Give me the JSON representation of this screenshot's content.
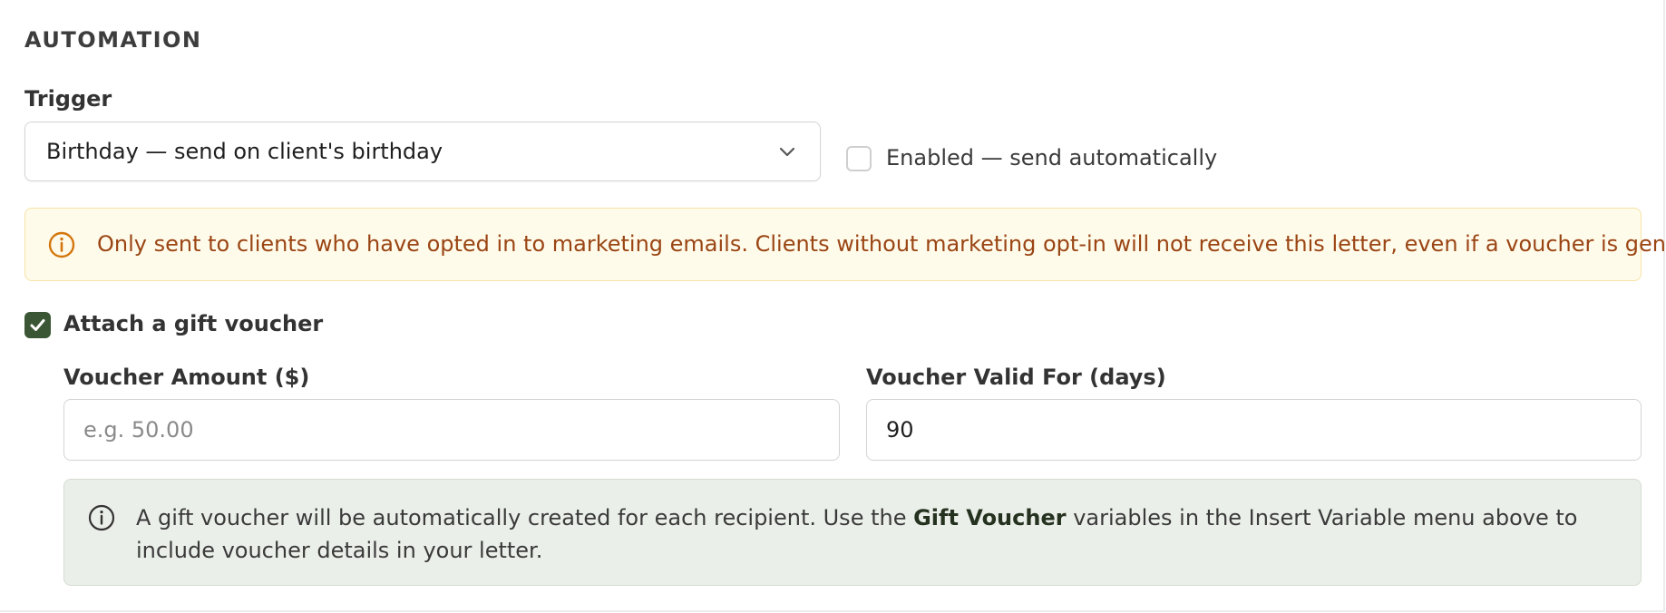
{
  "section": {
    "title": "AUTOMATION"
  },
  "trigger": {
    "label": "Trigger",
    "selected": "Birthday — send on client's birthday",
    "chevron_icon": "chevron-down-icon"
  },
  "enabled": {
    "label": "Enabled — send automatically",
    "checked": false
  },
  "warning": {
    "icon": "info-circle-icon",
    "text": "Only sent to clients who have opted in to marketing emails. Clients without marketing opt-in will not receive this letter, even if a voucher is generated.",
    "color": "#9a4514",
    "background": "#fffbea"
  },
  "attach_voucher": {
    "label": "Attach a gift voucher",
    "checked": true,
    "accent": "#3b5634"
  },
  "voucher_amount": {
    "label": "Voucher Amount ($)",
    "value": "",
    "placeholder": "e.g. 50.00"
  },
  "voucher_valid": {
    "label": "Voucher Valid For (days)",
    "value": "90",
    "placeholder": ""
  },
  "info": {
    "icon": "info-circle-icon",
    "text_before": "A gift voucher will be automatically created for each recipient. Use the ",
    "text_bold": "Gift Voucher",
    "text_after": " variables in the Insert Variable menu above to include voucher details in your letter."
  }
}
